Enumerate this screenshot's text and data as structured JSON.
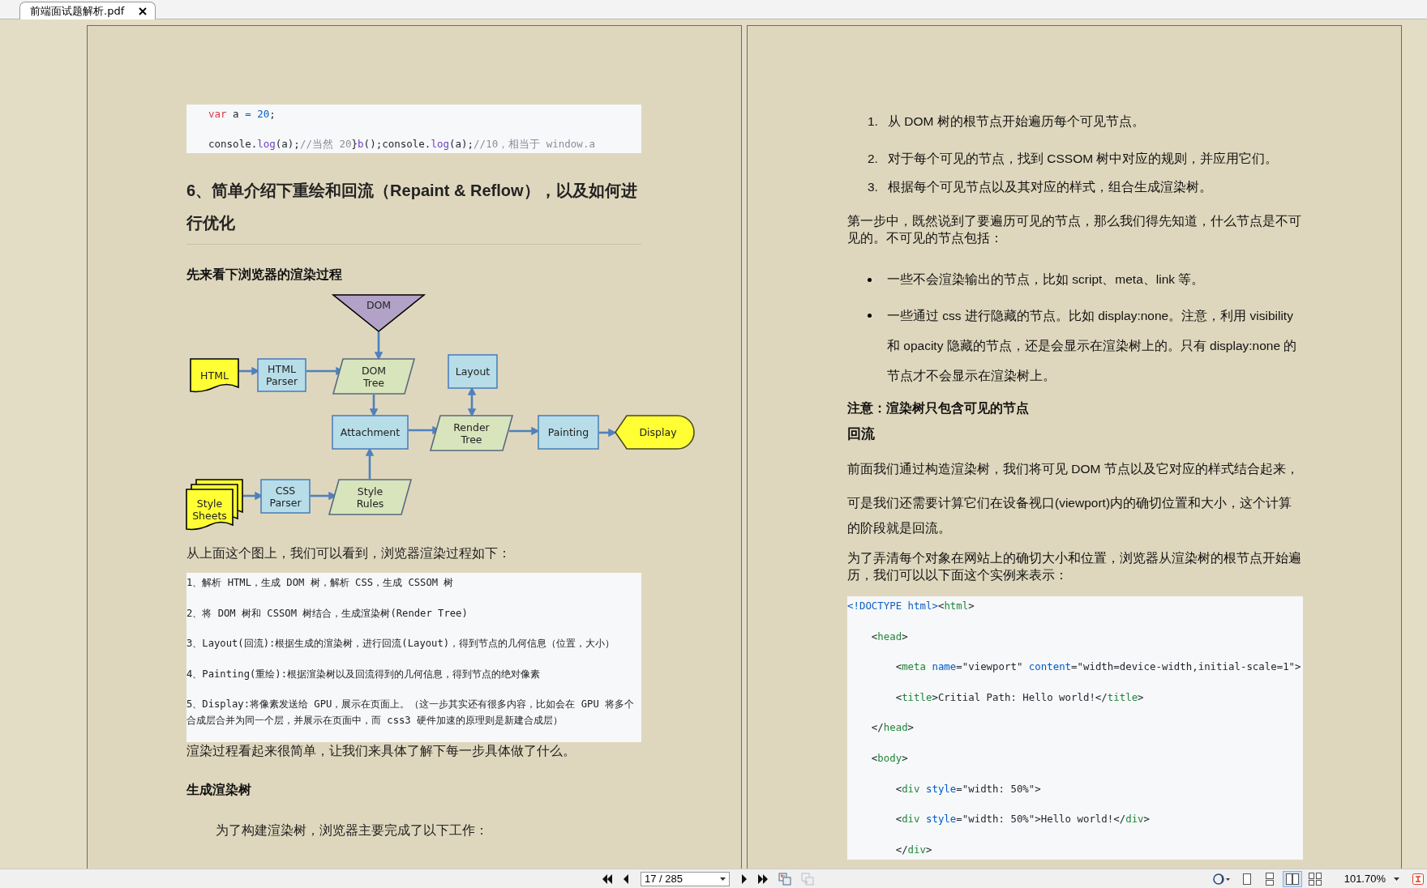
{
  "tabs": [
    {
      "label": "前端面试题解析.pdf",
      "selected": true
    }
  ],
  "left_page": {
    "code_block": {
      "lines": [
        [
          {
            "text": "var",
            "color": "#d73a49"
          },
          {
            "text": " a "
          },
          {
            "text": "= 20",
            "color": "#005cc5"
          },
          {
            "text": ";"
          }
        ],
        [
          {
            "text": "console."
          },
          {
            "text": "log",
            "color": "#6f42c1"
          },
          {
            "text": "(a);"
          },
          {
            "text": "//当然 20",
            "color": "#8a8f98"
          },
          {
            "text": "}"
          },
          {
            "text": "b",
            "color": "#6f42c1"
          },
          {
            "text": "();console."
          },
          {
            "text": "log",
            "color": "#6f42c1"
          },
          {
            "text": "(a);"
          },
          {
            "text": "//10，相当于 window.a",
            "color": "#8a8f98"
          }
        ]
      ]
    },
    "heading": "6、简单介绍下重绘和回流（Repaint & Reflow），以及如何进行优化",
    "subheading": "先来看下浏览器的渲染过程",
    "diagram": {
      "nodes": [
        {
          "kind": "triangle",
          "lines": [
            "DOM"
          ]
        },
        {
          "kind": "document",
          "lines": [
            "HTML"
          ]
        },
        {
          "kind": "process",
          "lines": [
            "HTML",
            "Parser"
          ]
        },
        {
          "kind": "data",
          "lines": [
            "DOM",
            "Tree"
          ]
        },
        {
          "kind": "process",
          "lines": [
            "Layout"
          ]
        },
        {
          "kind": "process",
          "lines": [
            "Attachment"
          ]
        },
        {
          "kind": "data",
          "lines": [
            "Render",
            "Tree"
          ]
        },
        {
          "kind": "process",
          "lines": [
            "Painting"
          ]
        },
        {
          "kind": "display",
          "lines": [
            "Display"
          ]
        },
        {
          "kind": "multidocument",
          "lines": [
            "Style",
            "Sheets"
          ]
        },
        {
          "kind": "process",
          "lines": [
            "CSS",
            "Parser"
          ]
        },
        {
          "kind": "data",
          "lines": [
            "Style",
            "Rules"
          ]
        }
      ]
    },
    "paragraph": "从上面这个图上，我们可以看到，浏览器渲染过程如下：",
    "steps": [
      "1、解析 HTML，生成 DOM 树，解析 CSS，生成 CSSOM 树",
      "2、将 DOM 树和 CSSOM 树结合，生成渲染树(Render Tree)",
      "3、Layout(回流):根据生成的渲染树，进行回流(Layout)，得到节点的几何信息（位置，大小）",
      "4、Painting(重绘):根据渲染树以及回流得到的几何信息，得到节点的绝对像素",
      "5、Display:将像素发送给 GPU，展示在页面上。（这一步其实还有很多内容，比如会在 GPU 将多个合成层合并为同一个层，并展示在页面中，而 css3 硬件加速的原理则是新建合成层）"
    ],
    "paragraph_2": "渲染过程看起来很简单，让我们来具体了解下每一步具体做了什么。",
    "section_heading": "生成渲染树",
    "paragraph_3": "为了构建渲染树，浏览器主要完成了以下工作："
  },
  "right_page": {
    "ordered_list": [
      {
        "number": "1.",
        "text": "从 DOM 树的根节点开始遍历每个可见节点。"
      },
      {
        "number": "2.",
        "text": "对于每个可见的节点，找到 CSSOM 树中对应的规则，并应用它们。"
      },
      {
        "number": "3.",
        "text": "根据每个可见节点以及其对应的样式，组合生成渲染树。"
      }
    ],
    "paragraph": "第一步中，既然说到了要遍历可见的节点，那么我们得先知道，什么节点是不可见的。不可见的节点包括：",
    "bullets": [
      "一些不会渲染输出的节点，比如 script、meta、link 等。",
      "一些通过 css 进行隐藏的节点。比如 display:none。注意，利用 visibility 和 opacity 隐藏的节点，还是会显示在渲染树上的。只有 display:none 的节点才不会显示在渲染树上。"
    ],
    "note": "注意：渲染树只包含可见的节点",
    "section_heading": "回流",
    "paragraphs": [
      "前面我们通过构造渲染树，我们将可见 DOM 节点以及它对应的样式结合起来，",
      "可是我们还需要计算它们在设备视口(viewport)内的确切位置和大小，这个计算的阶段就是回流。",
      "为了弄清每个对象在网站上的确切大小和位置，浏览器从渲染树的根节点开始遍历，我们可以以下面这个实例来表示："
    ],
    "code_block": {
      "lines": [
        [
          {
            "text": "<!DOCTYPE html>",
            "color": "#0f5fc5"
          },
          {
            "text": "<"
          },
          {
            "text": "html",
            "color": "#22863a"
          },
          {
            "text": ">"
          }
        ],
        [
          {
            "text": "    <"
          },
          {
            "text": "head",
            "color": "#22863a"
          },
          {
            "text": ">"
          }
        ],
        [
          {
            "text": "        <"
          },
          {
            "text": "meta",
            "color": "#22863a"
          },
          {
            "text": " name",
            "color": "#005cc5"
          },
          {
            "text": "=\"viewport\" "
          },
          {
            "text": "content",
            "color": "#005cc5"
          },
          {
            "text": "=\"width=device-width,initial-scale=1\">"
          }
        ],
        [
          {
            "text": "        <"
          },
          {
            "text": "title",
            "color": "#22863a"
          },
          {
            "text": ">Critial Path: Hello world!</"
          },
          {
            "text": "title",
            "color": "#22863a"
          },
          {
            "text": ">"
          }
        ],
        [
          {
            "text": "    </"
          },
          {
            "text": "head",
            "color": "#22863a"
          },
          {
            "text": ">"
          }
        ],
        [
          {
            "text": "    <"
          },
          {
            "text": "body",
            "color": "#22863a"
          },
          {
            "text": ">"
          }
        ],
        [
          {
            "text": "        <"
          },
          {
            "text": "div",
            "color": "#22863a"
          },
          {
            "text": " style",
            "color": "#005cc5"
          },
          {
            "text": "=\"width: 50%\">"
          }
        ],
        [
          {
            "text": "        <"
          },
          {
            "text": "div",
            "color": "#22863a"
          },
          {
            "text": " style",
            "color": "#005cc5"
          },
          {
            "text": "=\"width: 50%\">Hello world!</"
          },
          {
            "text": "div",
            "color": "#22863a"
          },
          {
            "text": ">"
          }
        ],
        [
          {
            "text": "        </"
          },
          {
            "text": "div",
            "color": "#22863a"
          },
          {
            "text": ">"
          }
        ]
      ]
    }
  },
  "toolbar": {
    "page_field": "17 / 285",
    "history_buttons": [
      {
        "disabled": false
      },
      {
        "disabled": true
      }
    ],
    "view_modes": [
      {
        "kind": "single",
        "selected": false
      },
      {
        "kind": "continuous",
        "selected": false
      },
      {
        "kind": "facing",
        "selected": true
      },
      {
        "kind": "facing_continuous",
        "selected": false
      }
    ],
    "zoom": "101.70%"
  }
}
